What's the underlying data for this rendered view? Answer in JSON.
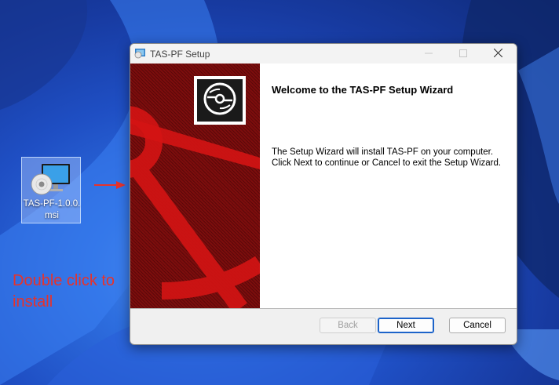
{
  "desktop": {
    "file_icon": {
      "label": "TAS-PF-1.0.0.msi",
      "icon": "msi-installer-icon"
    },
    "annotation": "Double click to install",
    "colors": {
      "annotation": "#e8322a",
      "wallpaper": "#1f4fc4"
    }
  },
  "window": {
    "title": "TAS-PF Setup",
    "heading": "Welcome to the TAS-PF Setup Wizard",
    "description": "The Setup Wizard will install TAS-PF on your computer. Click Next to continue or Cancel to exit the Setup Wizard.",
    "buttons": {
      "back": "Back",
      "next": "Next",
      "cancel": "Cancel"
    },
    "colors": {
      "banner": "#7d0d0d",
      "accent": "#1c63c9"
    }
  }
}
